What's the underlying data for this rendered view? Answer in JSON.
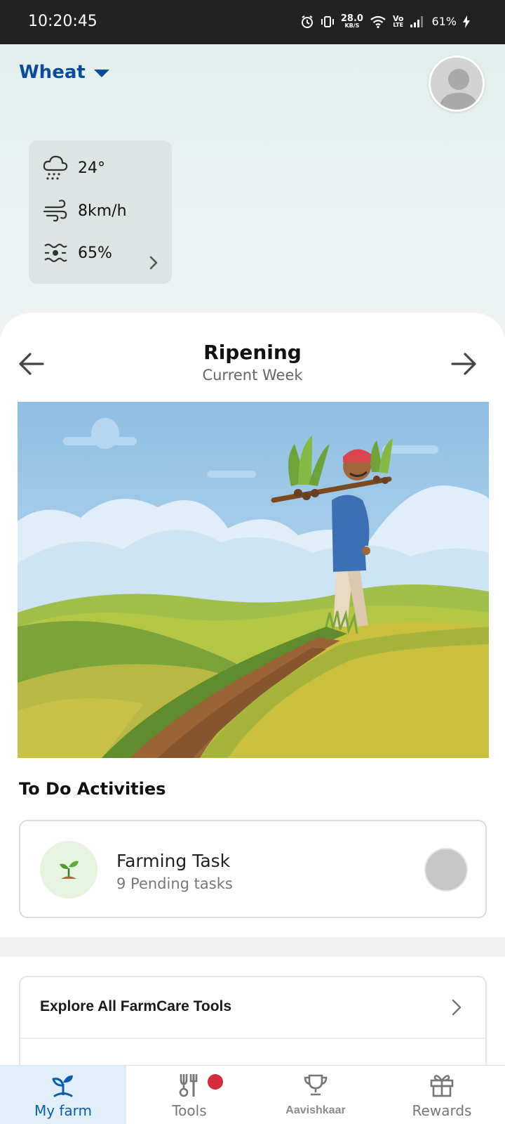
{
  "status_bar": {
    "time": "10:20:45",
    "net_speed_value": "28.0",
    "net_speed_unit": "KB/S",
    "volte_top": "Vo",
    "volte_bottom": "LTE",
    "battery": "61%"
  },
  "header": {
    "crop": "Wheat"
  },
  "weather": {
    "temperature": "24°",
    "wind": "8km/h",
    "humidity": "65%"
  },
  "stage": {
    "title": "Ripening",
    "subtitle": "Current Week"
  },
  "todo": {
    "heading": "To Do Activities",
    "task_title": "Farming Task",
    "task_subtitle": "9 Pending tasks"
  },
  "tools": {
    "explore_label": "Explore All FarmCare Tools"
  },
  "bottom_nav": [
    {
      "label": "My farm",
      "icon": "sprout-icon",
      "active": true
    },
    {
      "label": "Tools",
      "icon": "tools-icon",
      "badge": true
    },
    {
      "label": "Aavishkaar",
      "icon": "trophy-icon"
    },
    {
      "label": "Rewards",
      "icon": "gift-icon"
    }
  ],
  "colors": {
    "brand_blue": "#0a4ba0",
    "status_bar": "#222222",
    "header_bg": "#e2efed",
    "badge_red": "#d32f3a"
  }
}
